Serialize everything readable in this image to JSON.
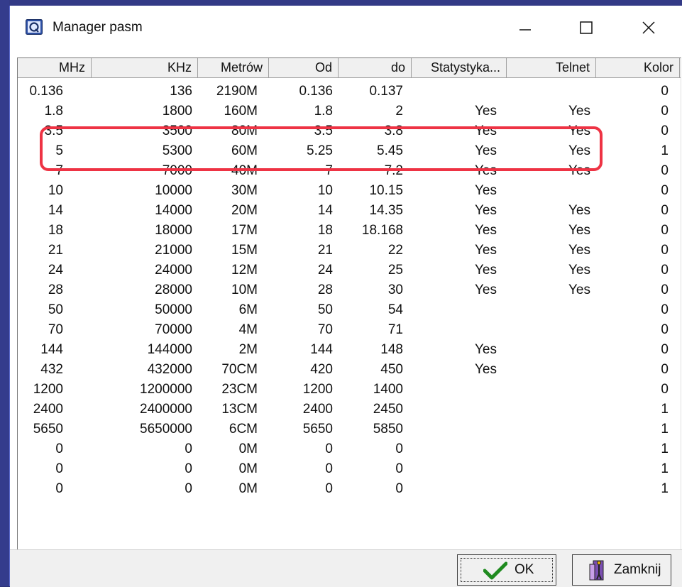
{
  "window": {
    "title": "Manager pasm"
  },
  "columns": [
    "MHz",
    "KHz",
    "Metrów",
    "Od",
    "do",
    "Statystyka...",
    "Telnet",
    "Kolor"
  ],
  "rows": [
    [
      "0.136",
      "136",
      "2190M",
      "0.136",
      "0.137",
      "",
      "",
      "0"
    ],
    [
      "1.8",
      "1800",
      "160M",
      "1.8",
      "2",
      "Yes",
      "Yes",
      "0"
    ],
    [
      "3.5",
      "3500",
      "80M",
      "3.5",
      "3.8",
      "Yes",
      "Yes",
      "0"
    ],
    [
      "5",
      "5300",
      "60M",
      "5.25",
      "5.45",
      "Yes",
      "Yes",
      "1"
    ],
    [
      "7",
      "7000",
      "40M",
      "7",
      "7.2",
      "Yes",
      "Yes",
      "0"
    ],
    [
      "10",
      "10000",
      "30M",
      "10",
      "10.15",
      "Yes",
      "",
      "0"
    ],
    [
      "14",
      "14000",
      "20M",
      "14",
      "14.35",
      "Yes",
      "Yes",
      "0"
    ],
    [
      "18",
      "18000",
      "17M",
      "18",
      "18.168",
      "Yes",
      "Yes",
      "0"
    ],
    [
      "21",
      "21000",
      "15M",
      "21",
      "22",
      "Yes",
      "Yes",
      "0"
    ],
    [
      "24",
      "24000",
      "12M",
      "24",
      "25",
      "Yes",
      "Yes",
      "0"
    ],
    [
      "28",
      "28000",
      "10M",
      "28",
      "30",
      "Yes",
      "Yes",
      "0"
    ],
    [
      "50",
      "50000",
      "6M",
      "50",
      "54",
      "",
      "",
      "0"
    ],
    [
      "70",
      "70000",
      "4M",
      "70",
      "71",
      "",
      "",
      "0"
    ],
    [
      "144",
      "144000",
      "2M",
      "144",
      "148",
      "Yes",
      "",
      "0"
    ],
    [
      "432",
      "432000",
      "70CM",
      "420",
      "450",
      "Yes",
      "",
      "0"
    ],
    [
      "1200",
      "1200000",
      "23CM",
      "1200",
      "1400",
      "",
      "",
      "0"
    ],
    [
      "2400",
      "2400000",
      "13CM",
      "2400",
      "2450",
      "",
      "",
      "1"
    ],
    [
      "5650",
      "5650000",
      "6CM",
      "5650",
      "5850",
      "",
      "",
      "1"
    ],
    [
      "0",
      "0",
      "0M",
      "0",
      "0",
      "",
      "",
      "1"
    ],
    [
      "0",
      "0",
      "0M",
      "0",
      "0",
      "",
      "",
      "1"
    ],
    [
      "0",
      "0",
      "0M",
      "0",
      "0",
      "",
      "",
      "1"
    ]
  ],
  "buttons": {
    "ok": "OK",
    "close": "Zamknij"
  },
  "icons": {
    "app": "app-logo-icon",
    "ok": "checkmark-icon",
    "close": "exit-door-icon"
  },
  "colors": {
    "highlight": "#ee3344",
    "desktop": "#2c3377"
  }
}
